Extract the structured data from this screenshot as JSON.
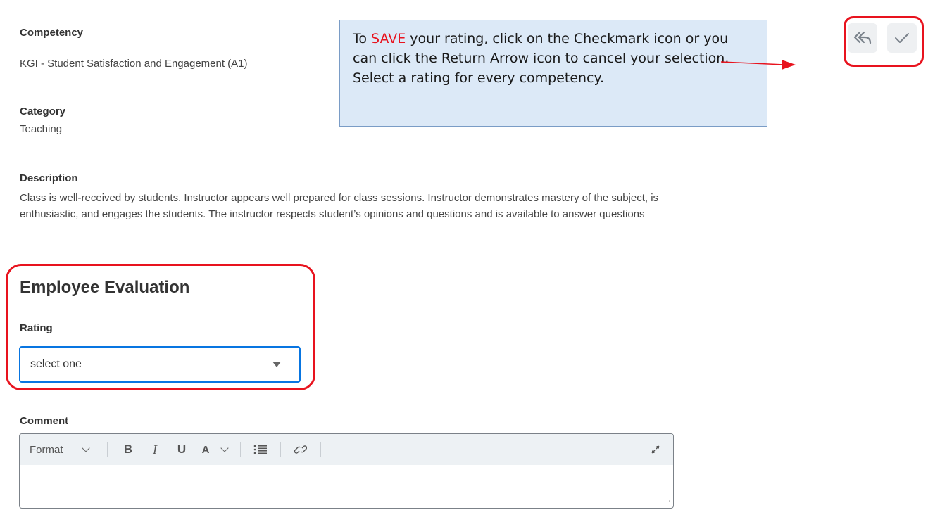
{
  "competency": {
    "label": "Competency",
    "value": "KGI - Student Satisfaction and Engagement (A1)"
  },
  "category": {
    "label": "Category",
    "value": "Teaching"
  },
  "description": {
    "label": "Description",
    "text": "Class is well-received by students. Instructor appears well prepared for class sessions. Instructor demonstrates mastery of the subject, is enthusiastic, and engages the students. The instructor respects student’s opinions and questions and is available to answer questions"
  },
  "evaluation": {
    "heading": "Employee Evaluation",
    "rating_label": "Rating",
    "rating_value": "select one"
  },
  "comment": {
    "label": "Comment",
    "toolbar": {
      "format": "Format",
      "bold": "B",
      "italic": "I",
      "underline": "U",
      "text_color": "A"
    }
  },
  "callout": {
    "save_word": "SAVE",
    "before": "To ",
    "after": " your rating, click on the Checkmark icon or you can click the Return Arrow icon to cancel your selection. Select a rating for every competency."
  },
  "actions": {
    "cancel_icon": "return-arrow-icon",
    "save_icon": "checkmark-icon"
  },
  "colors": {
    "highlight": "#e8131e",
    "accent": "#0875e1",
    "callout_bg": "#dce9f7"
  }
}
